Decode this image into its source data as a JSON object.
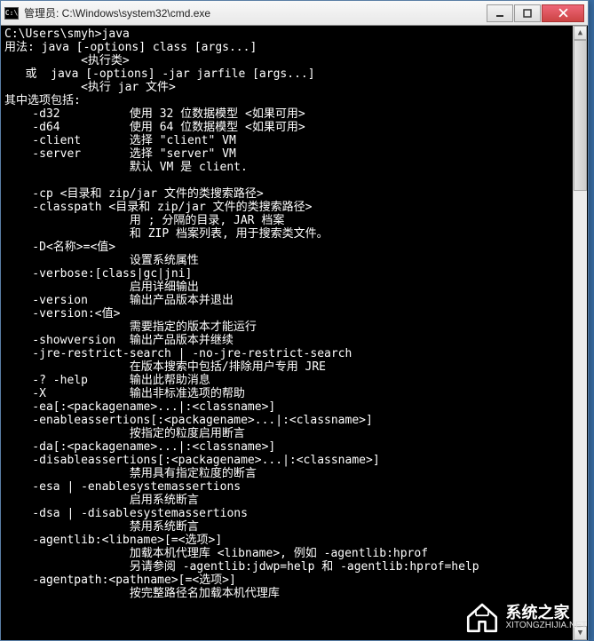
{
  "titlebar": {
    "icon_text": "C:\\",
    "title": "管理员: C:\\Windows\\system32\\cmd.exe"
  },
  "buttons": {
    "min": "minimize",
    "max": "maximize",
    "close": "close"
  },
  "term_lines": [
    "C:\\Users\\smyh>java",
    "用法: java [-options] class [args...]",
    "           <执行类>",
    "   或  java [-options] -jar jarfile [args...]",
    "           <执行 jar 文件>",
    "其中选项包括:",
    "    -d32          使用 32 位数据模型 <如果可用>",
    "    -d64          使用 64 位数据模型 <如果可用>",
    "    -client       选择 \"client\" VM",
    "    -server       选择 \"server\" VM",
    "                  默认 VM 是 client.",
    "",
    "    -cp <目录和 zip/jar 文件的类搜索路径>",
    "    -classpath <目录和 zip/jar 文件的类搜索路径>",
    "                  用 ; 分隔的目录, JAR 档案",
    "                  和 ZIP 档案列表, 用于搜索类文件。",
    "    -D<名称>=<值>",
    "                  设置系统属性",
    "    -verbose:[class|gc|jni]",
    "                  启用详细输出",
    "    -version      输出产品版本并退出",
    "    -version:<值>",
    "                  需要指定的版本才能运行",
    "    -showversion  输出产品版本并继续",
    "    -jre-restrict-search | -no-jre-restrict-search",
    "                  在版本搜索中包括/排除用户专用 JRE",
    "    -? -help      输出此帮助消息",
    "    -X            输出非标准选项的帮助",
    "    -ea[:<packagename>...|:<classname>]",
    "    -enableassertions[:<packagename>...|:<classname>]",
    "                  按指定的粒度启用断言",
    "    -da[:<packagename>...|:<classname>]",
    "    -disableassertions[:<packagename>...|:<classname>]",
    "                  禁用具有指定粒度的断言",
    "    -esa | -enablesystemassertions",
    "                  启用系统断言",
    "    -dsa | -disablesystemassertions",
    "                  禁用系统断言",
    "    -agentlib:<libname>[=<选项>]",
    "                  加载本机代理库 <libname>, 例如 -agentlib:hprof",
    "                  另请参阅 -agentlib:jdwp=help 和 -agentlib:hprof=help",
    "    -agentpath:<pathname>[=<选项>]",
    "                  按完整路径名加载本机代理库"
  ],
  "watermark": {
    "main": "系统之家",
    "sub": "XITONGZHIJIA.NET"
  }
}
